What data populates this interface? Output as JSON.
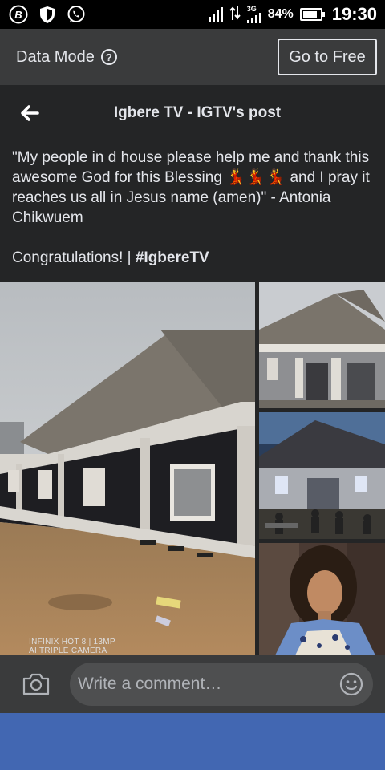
{
  "status_bar": {
    "battery": "84%",
    "battery_level": 0.84,
    "time": "19:30",
    "network_type": "3G",
    "icons": [
      "b-icon",
      "shield-icon",
      "whatsapp-icon",
      "signal-icon",
      "data-arrows-icon",
      "battery-icon"
    ]
  },
  "data_mode": {
    "label": "Data Mode",
    "help": "?",
    "button": "Go to Free"
  },
  "header": {
    "title": "Igbere TV - IGTV's post"
  },
  "post": {
    "text_before": "\"My people in d house please help me and thank  this awesome God for this Blessing ",
    "dancers": "💃💃💃",
    "text_after": " and I pray it reaches us all in Jesus name (amen)\" - Antonia Chikwuem",
    "congrats": "Congratulations! | ",
    "hashtag": "#IgbereTV",
    "watermark_line1": "INFINIX HOT 8 | 13MP",
    "watermark_line2": "AI TRIPLE CAMERA"
  },
  "comment": {
    "placeholder": "Write a comment…"
  },
  "colors": {
    "background": "#242526",
    "bar": "#3a3b3c",
    "accent_blue": "#4267b2"
  }
}
